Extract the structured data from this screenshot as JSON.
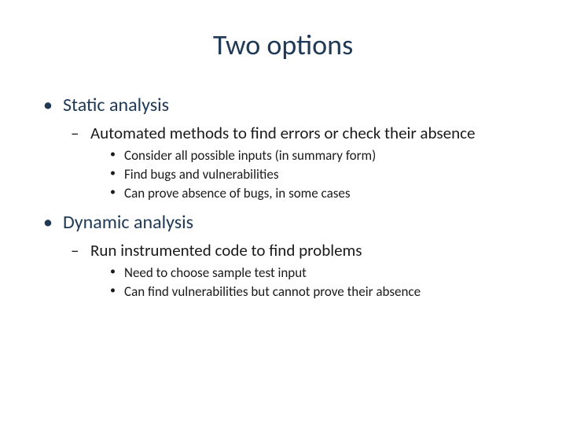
{
  "slide": {
    "title": "Two options",
    "bullets": [
      {
        "text": "Static analysis",
        "children": [
          {
            "text": "Automated methods to find errors or check their absence",
            "children": [
              {
                "text": "Consider all possible inputs (in summary form)"
              },
              {
                "text": "Find bugs and vulnerabilities"
              },
              {
                "text": "Can prove absence of bugs, in some cases"
              }
            ]
          }
        ]
      },
      {
        "text": "Dynamic analysis",
        "children": [
          {
            "text": "Run instrumented code to find problems",
            "children": [
              {
                "text": "Need to choose sample test input"
              },
              {
                "text": "Can find vulnerabilities but cannot prove their absence"
              }
            ]
          }
        ]
      }
    ]
  }
}
